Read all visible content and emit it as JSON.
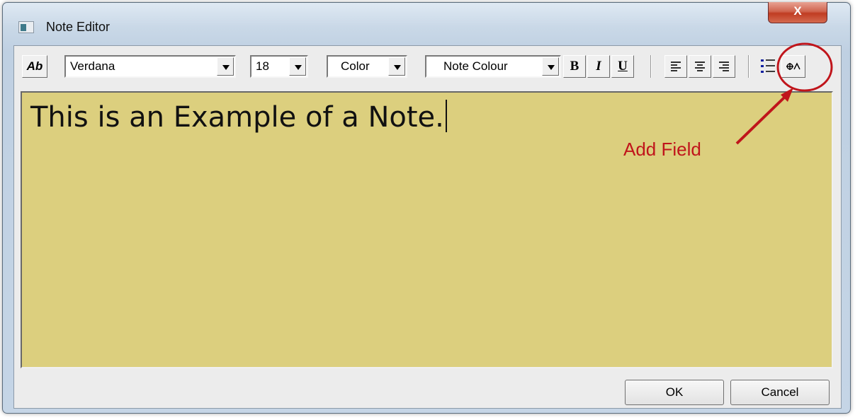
{
  "window": {
    "title": "Note Editor",
    "close_glyph": "X"
  },
  "toolbar": {
    "font_style_icon": "Ab",
    "font": "Verdana",
    "size": "18",
    "color": "Color",
    "note_colour": "Note Colour",
    "bold": "B",
    "italic": "I",
    "underline": "U"
  },
  "note": {
    "text": "This is an Example of a Note.",
    "background": "#dccf7e"
  },
  "buttons": {
    "ok": "OK",
    "cancel": "Cancel"
  },
  "annotation": {
    "label": "Add Field",
    "color": "#c0151b"
  }
}
